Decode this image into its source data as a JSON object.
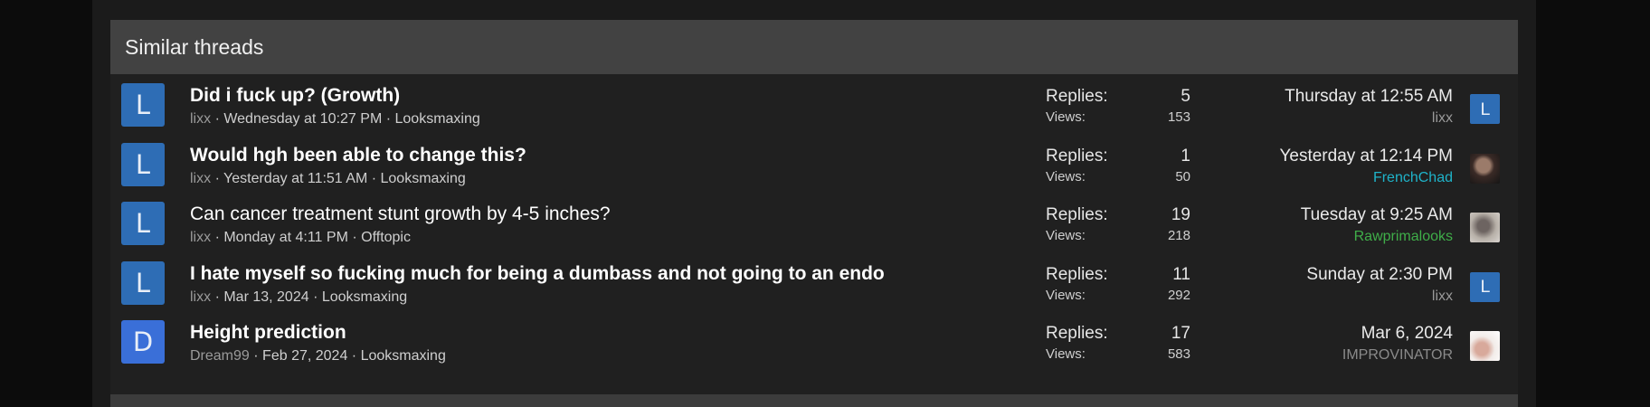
{
  "section": {
    "title": "Similar threads"
  },
  "stats_labels": {
    "replies": "Replies:",
    "views": "Views:"
  },
  "colors": {
    "avatar_l": "#2e6db5",
    "avatar_d": "#3a6fd8",
    "username_default": "#9a9a9a",
    "username_cyan": "#1fb3c9",
    "username_green": "#3fae49",
    "username_gray": "#8a8a8a"
  },
  "threads": [
    {
      "title": "Did i fuck up? (Growth)",
      "bold": true,
      "avatar_letter": "L",
      "author": "lixx",
      "date": "Wednesday at 10:27 PM",
      "forum": "Looksmaxing",
      "replies": "5",
      "views": "153",
      "last_date": "Thursday at 12:55 AM",
      "last_user": "lixx",
      "last_user_color": "#9a9a9a",
      "last_avatar": "letter",
      "last_avatar_letter": "L"
    },
    {
      "title": "Would hgh been able to change this?",
      "bold": true,
      "avatar_letter": "L",
      "author": "lixx",
      "date": "Yesterday at 11:51 AM",
      "forum": "Looksmaxing",
      "replies": "1",
      "views": "50",
      "last_date": "Yesterday at 12:14 PM",
      "last_user": "FrenchChad",
      "last_user_color": "#1fb3c9",
      "last_avatar": "photo-dark",
      "last_avatar_letter": ""
    },
    {
      "title": "Can cancer treatment stunt growth by 4-5 inches?",
      "bold": false,
      "avatar_letter": "L",
      "author": "lixx",
      "date": "Monday at 4:11 PM",
      "forum": "Offtopic",
      "replies": "19",
      "views": "218",
      "last_date": "Tuesday at 9:25 AM",
      "last_user": "Rawprimalooks",
      "last_user_color": "#3fae49",
      "last_avatar": "photo-light",
      "last_avatar_letter": ""
    },
    {
      "title": "I hate myself so fucking much for being a dumbass and not going to an endo",
      "bold": true,
      "avatar_letter": "L",
      "author": "lixx",
      "date": "Mar 13, 2024",
      "forum": "Looksmaxing",
      "replies": "11",
      "views": "292",
      "last_date": "Sunday at 2:30 PM",
      "last_user": "lixx",
      "last_user_color": "#9a9a9a",
      "last_avatar": "letter",
      "last_avatar_letter": "L"
    },
    {
      "title": "Height prediction",
      "bold": true,
      "avatar_letter": "D",
      "author": "Dream99",
      "date": "Feb 27, 2024",
      "forum": "Looksmaxing",
      "replies": "17",
      "views": "583",
      "last_date": "Mar 6, 2024",
      "last_user": "IMPROVINATOR",
      "last_user_color": "#8a8a8a",
      "last_avatar": "photo-white",
      "last_avatar_letter": ""
    }
  ]
}
